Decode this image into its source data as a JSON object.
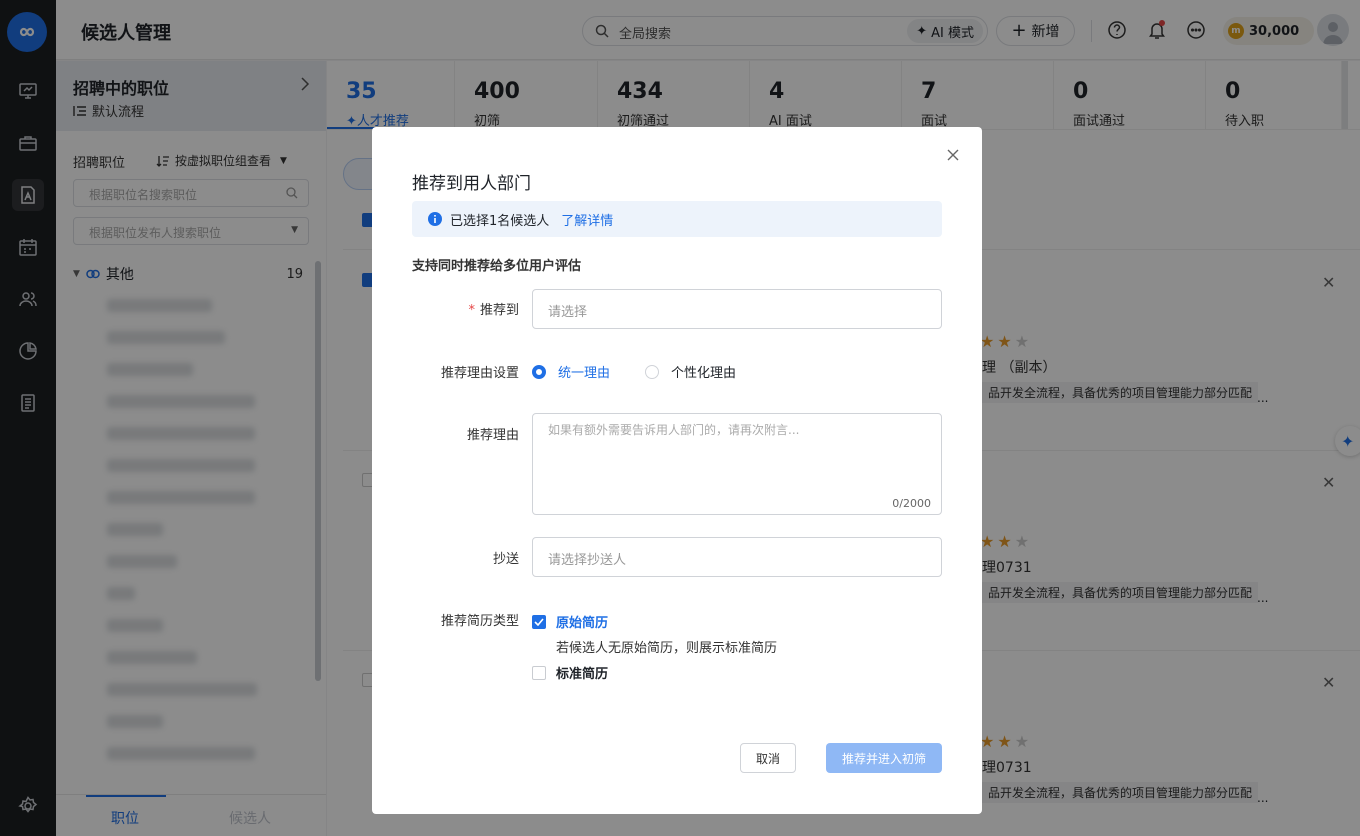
{
  "topbar": {
    "title": "候选人管理",
    "search_placeholder": "全局搜索",
    "ai_mode_label": "AI 模式",
    "new_label": "新增",
    "coins": "30,000"
  },
  "sidebar": {
    "position_title": "招聘中的职位",
    "workflow": "默认流程",
    "recruiting_label": "招聘职位",
    "view_by": "按虚拟职位组查看",
    "search_by_name": "根据职位名搜索职位",
    "search_by_publisher": "根据职位发布人搜索职位",
    "group_name": "其他",
    "group_count": "19",
    "tabs": [
      "职位",
      "候选人"
    ]
  },
  "stats": [
    {
      "count": "35",
      "label": "人才推荐"
    },
    {
      "count": "400",
      "label": "初筛"
    },
    {
      "count": "434",
      "label": "初筛通过"
    },
    {
      "count": "4",
      "label": "AI 面试"
    },
    {
      "count": "7",
      "label": "面试"
    },
    {
      "count": "0",
      "label": "面试通过"
    },
    {
      "count": "0",
      "label": "待入职"
    }
  ],
  "cards": [
    {
      "title": "理 （副本）",
      "desc": "品开发全流程，具备优秀的项目管理能力部分匹配",
      "rating": 3
    },
    {
      "title": "理0731",
      "desc": "品开发全流程，具备优秀的项目管理能力部分匹配",
      "rating": 3
    },
    {
      "title": "理0731",
      "desc": "品开发全流程，具备优秀的项目管理能力部分匹配",
      "rating": 3
    }
  ],
  "modal": {
    "title": "推荐到用人部门",
    "info_text": "已选择1名候选人",
    "info_link": "了解详情",
    "hint": "支持同时推荐给多位用户评估",
    "recommend_to_label": "推荐到",
    "recommend_to_placeholder": "请选择",
    "reason_setting_label": "推荐理由设置",
    "reason_option_unified": "统一理由",
    "reason_option_personal": "个性化理由",
    "reason_label": "推荐理由",
    "reason_placeholder": "如果有额外需要告诉用人部门的，请再次附言...",
    "reason_counter": "0/2000",
    "cc_label": "抄送",
    "cc_placeholder": "请选择抄送人",
    "resume_type_label": "推荐简历类型",
    "resume_original": "原始简历",
    "resume_original_note": "若候选人无原始简历，则展示标准简历",
    "resume_standard": "标准简历",
    "cancel": "取消",
    "submit": "推荐并进入初筛"
  },
  "colors": {
    "primary": "#1f6fe5",
    "rail": "#1d1f22",
    "star": "#e89b2d"
  }
}
